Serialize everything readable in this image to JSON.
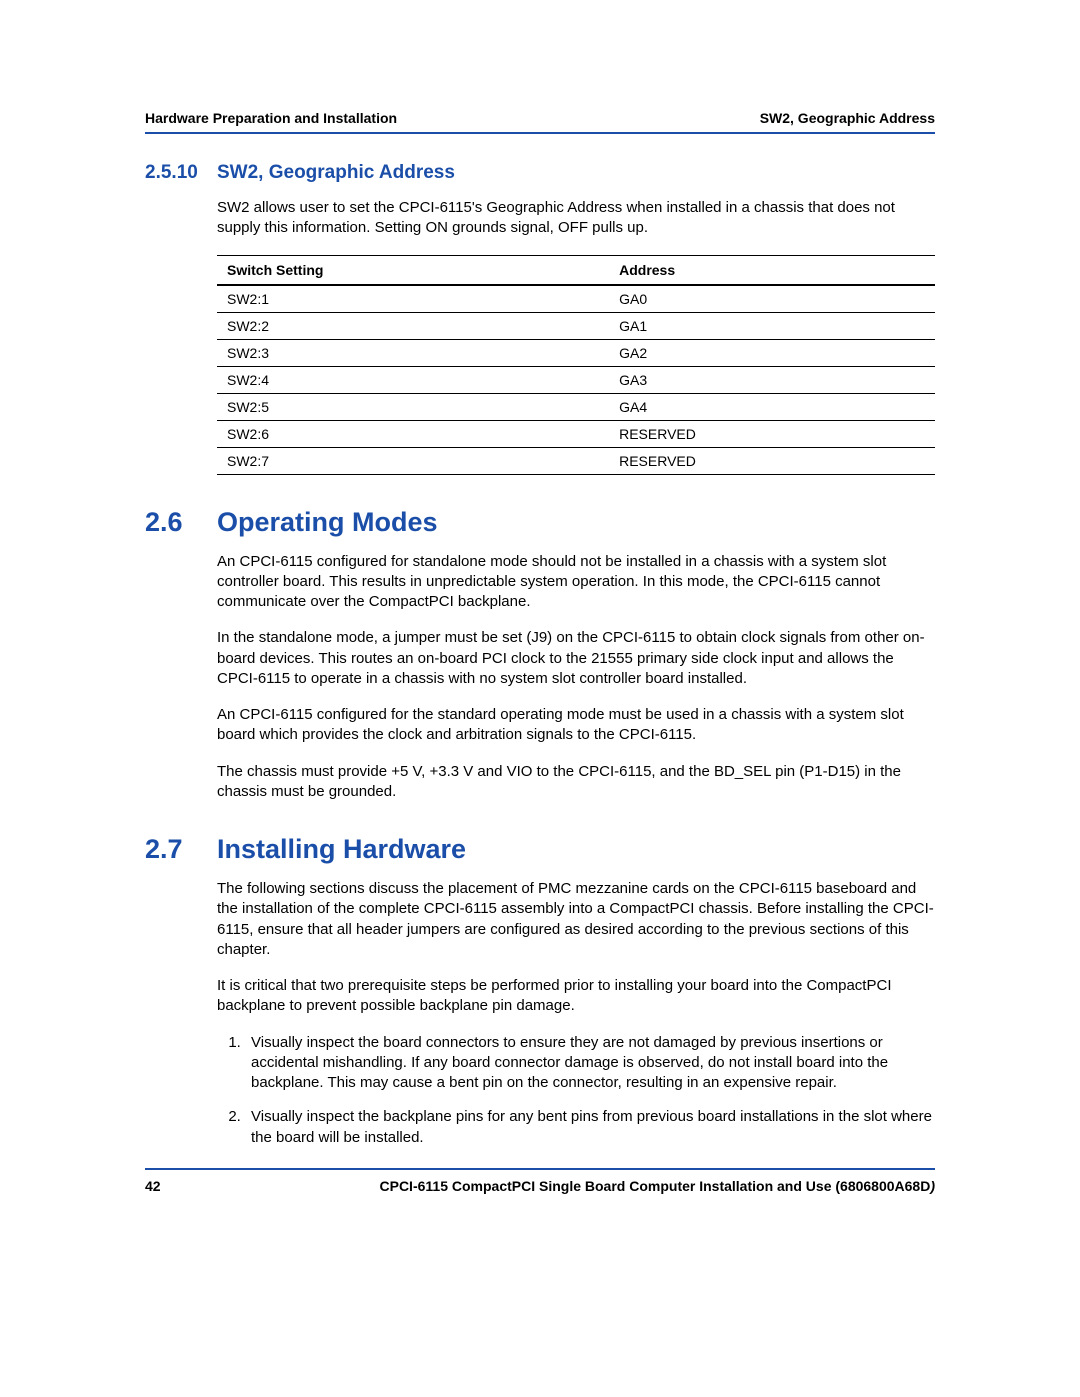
{
  "header": {
    "left": "Hardware Preparation and Installation",
    "right": "SW2, Geographic Address"
  },
  "section_2_5_10": {
    "number": "2.5.10",
    "title": "SW2, Geographic Address",
    "para": "SW2 allows user to set the CPCI-6115's Geographic Address when installed in a chassis that does not supply this information.  Setting ON grounds signal, OFF pulls up."
  },
  "table": {
    "headers": {
      "col1": "Switch Setting",
      "col2": "Address"
    },
    "rows": [
      {
        "c1": "SW2:1",
        "c2": "GA0"
      },
      {
        "c1": "SW2:2",
        "c2": "GA1"
      },
      {
        "c1": "SW2:3",
        "c2": "GA2"
      },
      {
        "c1": "SW2:4",
        "c2": "GA3"
      },
      {
        "c1": "SW2:5",
        "c2": "GA4"
      },
      {
        "c1": "SW2:6",
        "c2": "RESERVED"
      },
      {
        "c1": "SW2:7",
        "c2": "RESERVED"
      }
    ]
  },
  "section_2_6": {
    "number": "2.6",
    "title": "Operating Modes",
    "p1": "An CPCI-6115 configured for standalone mode should not be installed in a chassis with a system slot controller board. This results in unpredictable system operation. In this mode, the CPCI-6115 cannot communicate over the CompactPCI backplane.",
    "p2": "In the standalone mode, a jumper must be set (J9) on the CPCI-6115 to obtain clock signals from other on-board devices. This routes an on-board PCI clock to the 21555 primary side clock input and allows the CPCI-6115 to operate in a chassis with no system slot controller board installed.",
    "p3": "An CPCI-6115 configured for the standard operating mode must be used in a chassis with a system slot board which provides the clock and arbitration signals to the CPCI-6115.",
    "p4": "The chassis must provide +5 V, +3.3 V and VIO to the CPCI-6115, and the BD_SEL pin (P1-D15) in the chassis must be grounded."
  },
  "section_2_7": {
    "number": "2.7",
    "title": "Installing Hardware",
    "p1": "The following sections discuss the placement of PMC mezzanine cards on the CPCI-6115 baseboard and the installation of the complete CPCI-6115 assembly into a CompactPCI chassis. Before installing the CPCI-6115, ensure that all header jumpers are configured as desired according to the previous sections of this chapter.",
    "p2": "It is critical that two prerequisite steps be performed prior to installing your board into the CompactPCI backplane to prevent possible backplane pin damage.",
    "steps": [
      "Visually inspect the board connectors to ensure they are not damaged by previous insertions or accidental mishandling. If any board connector damage is observed, do not install board into the backplane. This may cause a bent pin on the connector, resulting in an expensive repair.",
      "Visually inspect the backplane pins for any bent pins from previous board installations in the slot where the board will be installed."
    ]
  },
  "footer": {
    "page": "42",
    "title_main": "CPCI-6115 CompactPCI Single Board Computer Installation and Use (6806800A68D",
    "title_tail": ")"
  }
}
